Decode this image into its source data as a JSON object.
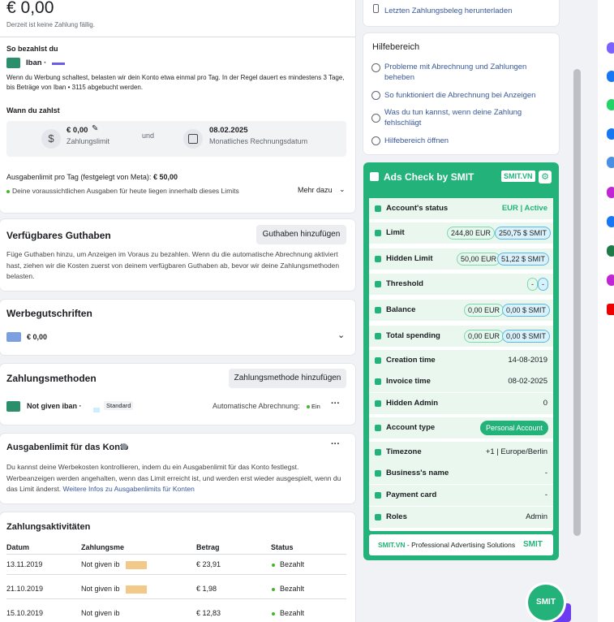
{
  "balance": {
    "amount": "€ 0,00",
    "note": "Derzeit ist keine Zahlung fällig."
  },
  "payment_method_section": {
    "title": "So bezahlst du",
    "method": "Iban · ",
    "description": "Wenn du Werbung schaltest, belasten wir dein Konto etwa einmal pro Tag. In der Regel dauert es mindestens 3 Tage, bis Beträge von Iban • 3115 abgebucht werden.",
    "when_title": "Wann du zahlst",
    "limit_value": "€ 0,00",
    "limit_label": "Zahlungslimit",
    "and": "und",
    "date_value": "08.02.2025",
    "date_label": "Monatliches Rechnungsdatum",
    "daily_limit_label": "Ausgabenlimit pro Tag (festgelegt von Meta): ",
    "daily_limit_value": "€ 50,00",
    "projection": "Deine voraussichtlichen Ausgaben für heute liegen innerhalb dieses Limits",
    "more": "Mehr dazu"
  },
  "prepaid": {
    "title": "Verfügbares Guthaben",
    "button": "Guthaben hinzufügen",
    "description": "Füge Guthaben hinzu, um Anzeigen im Voraus zu bezahlen. Wenn du die automatische Abrechnung aktiviert hast, ziehen wir die Kosten zuerst von deinem verfügbaren Guthaben ab, bevor wir deine Zahlungsmethoden belasten."
  },
  "credits": {
    "title": "Werbegutschriften",
    "value": "€ 0,00"
  },
  "methods": {
    "title": "Zahlungsmethoden",
    "button": "Zahlungsmethode hinzufügen",
    "item_name": "Not given iban ·",
    "badge": "Standard",
    "auto_label": "Automatische Abrechnung:",
    "auto_value": "Ein"
  },
  "account_limit": {
    "title": "Ausgabenlimit für das Konto",
    "description": "Du kannst deine Werbekosten kontrollieren, indem du ein Ausgabenlimit für das Konto festlegst. Werbeanzeigen werden angehalten, wenn das Limit erreicht ist, und werden erst wieder ausgespielt, wenn du das Limit änderst. ",
    "link": "Weitere Infos zu Ausgabenlimits für Konten"
  },
  "activity": {
    "title": "Zahlungsaktivitäten",
    "headers": [
      "Datum",
      "Zahlungsme",
      "Betrag",
      "Status"
    ],
    "rows": [
      {
        "date": "13.11.2019",
        "method": "Not given ib",
        "amount": "€ 23,91",
        "status": "Bezahlt"
      },
      {
        "date": "21.10.2019",
        "method": "Not given ib",
        "amount": "€ 1,98",
        "status": "Bezahlt"
      },
      {
        "date": "15.10.2019",
        "method": "Not given ib",
        "amount": "€ 12,83",
        "status": "Bezahlt"
      }
    ]
  },
  "receipt_link": "Letzten Zahlungsbeleg herunterladen",
  "help": {
    "title": "Hilfebereich",
    "links": [
      "Probleme mit Abrechnung und Zahlungen beheben",
      "So funktioniert die Abrechnung bei Anzeigen",
      "Was du tun kannst, wenn deine Zahlung fehlschlägt",
      "Hilfebereich öffnen"
    ]
  },
  "smit": {
    "title": "Ads Check by SMIT",
    "badge": "SMIT.VN",
    "rows": {
      "status_label": "Account's status",
      "status_value": "EUR | Active",
      "limit_label": "Limit",
      "limit_eur": "244,80 EUR",
      "limit_smit": "250,75 $ SMIT",
      "hidden_label": "Hidden Limit",
      "hidden_eur": "50,00 EUR",
      "hidden_smit": "51,22 $ SMIT",
      "threshold_label": "Threshold",
      "threshold_a": "-",
      "threshold_b": "-",
      "balance_label": "Balance",
      "balance_eur": "0,00 EUR",
      "balance_smit": "0,00 $ SMIT",
      "spending_label": "Total spending",
      "spending_eur": "0,00 EUR",
      "spending_smit": "0,00 $ SMIT",
      "creation_label": "Creation time",
      "creation_value": "14-08-2019",
      "invoice_label": "Invoice time",
      "invoice_value": "08-02-2025",
      "admin_label": "Hidden Admin",
      "admin_value": "0",
      "type_label": "Account type",
      "type_value": "Personal Account",
      "tz_label": "Timezone",
      "tz_value": "+1 | Europe/Berlin",
      "bname_label": "Business's name",
      "bname_value": "-",
      "card_label": "Payment card",
      "card_value": "-",
      "roles_label": "Roles",
      "roles_value": "Admin"
    },
    "footer_brand": "SMIT.VN",
    "footer_text": " - Professional Advertising Solutions",
    "footer_logo": "SMIT",
    "fab": "SMIT"
  },
  "colors": {
    "smit_green": "#23b37a",
    "link_blue": "#385898",
    "status_green": "#42b72a"
  }
}
